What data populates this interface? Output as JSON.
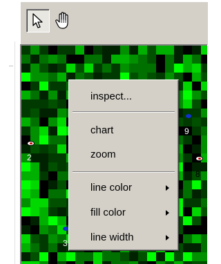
{
  "toolbar": {
    "tools": [
      {
        "name": "select-arrow",
        "icon": "arrow-cursor-icon",
        "pressed": true
      },
      {
        "name": "pan-hand",
        "icon": "hand-icon",
        "pressed": false
      }
    ]
  },
  "canvas": {
    "palette": [
      "#00ff00",
      "#00d800",
      "#00b000",
      "#009000",
      "#007000",
      "#005000",
      "#003a00",
      "#002200",
      "#000000"
    ],
    "node_labels": [
      "2",
      "9",
      "8",
      "3"
    ]
  },
  "context_menu": {
    "items": [
      {
        "label": "inspect...",
        "submenu": false
      },
      {
        "label": "chart",
        "submenu": false
      },
      {
        "label": "zoom",
        "submenu": false
      },
      {
        "label": "line color",
        "submenu": true
      },
      {
        "label": "fill color",
        "submenu": true
      },
      {
        "label": "line width",
        "submenu": true
      }
    ]
  }
}
